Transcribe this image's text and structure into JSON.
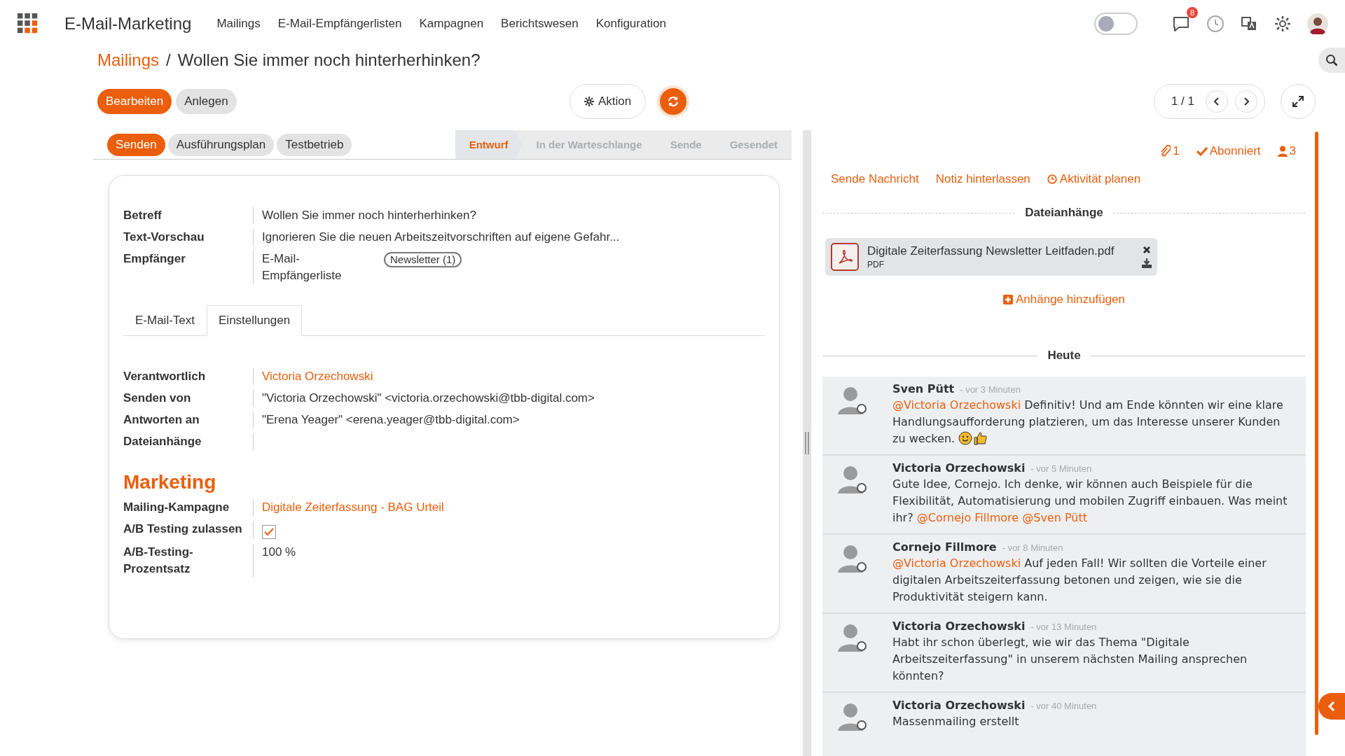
{
  "app": {
    "title": "E-Mail-Marketing",
    "menu": [
      "Mailings",
      "E-Mail-Empfängerlisten",
      "Kampagnen",
      "Berichtswesen",
      "Konfiguration"
    ],
    "dark_mode": {
      "on": false
    },
    "notifications": {
      "count": "8"
    }
  },
  "breadcrumb": {
    "parent": "Mailings",
    "separator": "/",
    "current": "Wollen Sie immer noch hinterherhinken?"
  },
  "toolbar": {
    "buttons": [
      {
        "label": "Bearbeiten",
        "primary": true
      },
      {
        "label": "Anlegen",
        "primary": false
      }
    ],
    "action": "Aktion",
    "pager": "1 / 1"
  },
  "status_bar": {
    "buttons": [
      {
        "label": "Senden",
        "primary": true
      },
      {
        "label": "Ausführungsplan",
        "primary": false
      },
      {
        "label": "Testbetrieb",
        "primary": false
      }
    ],
    "stages": [
      {
        "label": "Entwurf",
        "selected": true
      },
      {
        "label": "In der Warteschlange",
        "selected": false
      },
      {
        "label": "Sende",
        "selected": false
      },
      {
        "label": "Gesendet",
        "selected": false
      }
    ]
  },
  "form": {
    "fields": [
      {
        "label": "Betreff",
        "kind": "text",
        "value": "Wollen Sie immer noch hinterherhinken?"
      },
      {
        "label": "Text-Vorschau",
        "kind": "text",
        "value": "Ignorieren Sie die neuen Arbeitszeitvorschriften auf eigene Gefahr..."
      },
      {
        "label": "Empfänger",
        "kind": "tag",
        "value": "E-Mail-Empfängerliste",
        "tag": "Newsletter (1)"
      }
    ],
    "tabs": [
      {
        "label": "E-Mail-Text",
        "selected": false
      },
      {
        "label": "Einstellungen",
        "selected": true
      }
    ],
    "settings": [
      {
        "label": "Verantwortlich",
        "kind": "link",
        "value": "Victoria Orzechowski"
      },
      {
        "label": "Senden von",
        "kind": "text",
        "value": "\"Victoria Orzechowski\" <victoria.orzechowski@tbb-digital.com>"
      },
      {
        "label": "Antworten an",
        "kind": "text",
        "value": "\"Erena Yeager\" <erena.yeager@tbb-digital.com>"
      },
      {
        "label": "Dateianhänge",
        "kind": "empty"
      }
    ],
    "section": {
      "title": "Marketing",
      "fields": [
        {
          "label": "Mailing-Kampagne",
          "kind": "link",
          "value": "Digitale Zeiterfassung - BAG Urteil"
        },
        {
          "label": "A/B Testing zulassen",
          "kind": "checkbox",
          "checked": true
        },
        {
          "label": "A/B-Testing-Prozentsatz",
          "kind": "text",
          "value": "100 %"
        }
      ]
    }
  },
  "chatter": {
    "attachments_count": "1",
    "subscription": "Abonniert",
    "followers": "3",
    "actions": [
      {
        "label": "Sende Nachricht",
        "kind": "plain"
      },
      {
        "label": "Notiz hinterlassen",
        "kind": "plain"
      },
      {
        "label": "Aktivität planen",
        "kind": "clock"
      }
    ],
    "attachments_title": "Dateianhänge",
    "attachments": [
      {
        "name": "Digitale Zeiterfassung Newsletter Leitfaden.pdf",
        "type": "PDF"
      }
    ],
    "add_attachment": "Anhänge hinzufügen",
    "day": "Heute",
    "messages": [
      {
        "author": "Sven Pütt",
        "time": "- vor 3 Minuten",
        "parts": [
          {
            "kind": "mention",
            "text": "@Victoria Orzechowski"
          },
          {
            "kind": "text",
            "text": " Definitiv! Und am Ende könnten wir eine klare Handlungsaufforderung platzieren, um das Interesse unserer Kunden zu wecken. "
          },
          {
            "kind": "smiley"
          },
          {
            "kind": "thumbs_up"
          }
        ]
      },
      {
        "author": "Victoria Orzechowski",
        "time": "- vor 5 Minuten",
        "parts": [
          {
            "kind": "text",
            "text": "Gute Idee, Cornejo. Ich denke, wir können auch Beispiele für die Flexibilität, Automatisierung und mobilen Zugriff einbauen. Was meint ihr? "
          },
          {
            "kind": "mention",
            "text": "@Cornejo Fillmore"
          },
          {
            "kind": "space"
          },
          {
            "kind": "mention",
            "text": "@Sven Pütt"
          }
        ]
      },
      {
        "author": "Cornejo Fillmore",
        "time": "- vor 8 Minuten",
        "parts": [
          {
            "kind": "mention",
            "text": "@Victoria Orzechowski"
          },
          {
            "kind": "text",
            "text": " Auf jeden Fall! Wir sollten die Vorteile einer digitalen Arbeitszeiterfassung betonen und zeigen, wie sie die Produktivität steigern kann."
          }
        ]
      },
      {
        "author": "Victoria Orzechowski",
        "time": "- vor 13 Minuten",
        "parts": [
          {
            "kind": "text",
            "text": "Habt ihr schon überlegt, wie wir das Thema \"Digitale Arbeitszeiterfassung\" in unserem nächsten Mailing ansprechen könnten?"
          }
        ]
      },
      {
        "author": "Victoria Orzechowski",
        "time": "- vor 40 Minuten",
        "parts": [
          {
            "kind": "text",
            "text": "Massenmailing erstellt"
          }
        ]
      }
    ]
  }
}
